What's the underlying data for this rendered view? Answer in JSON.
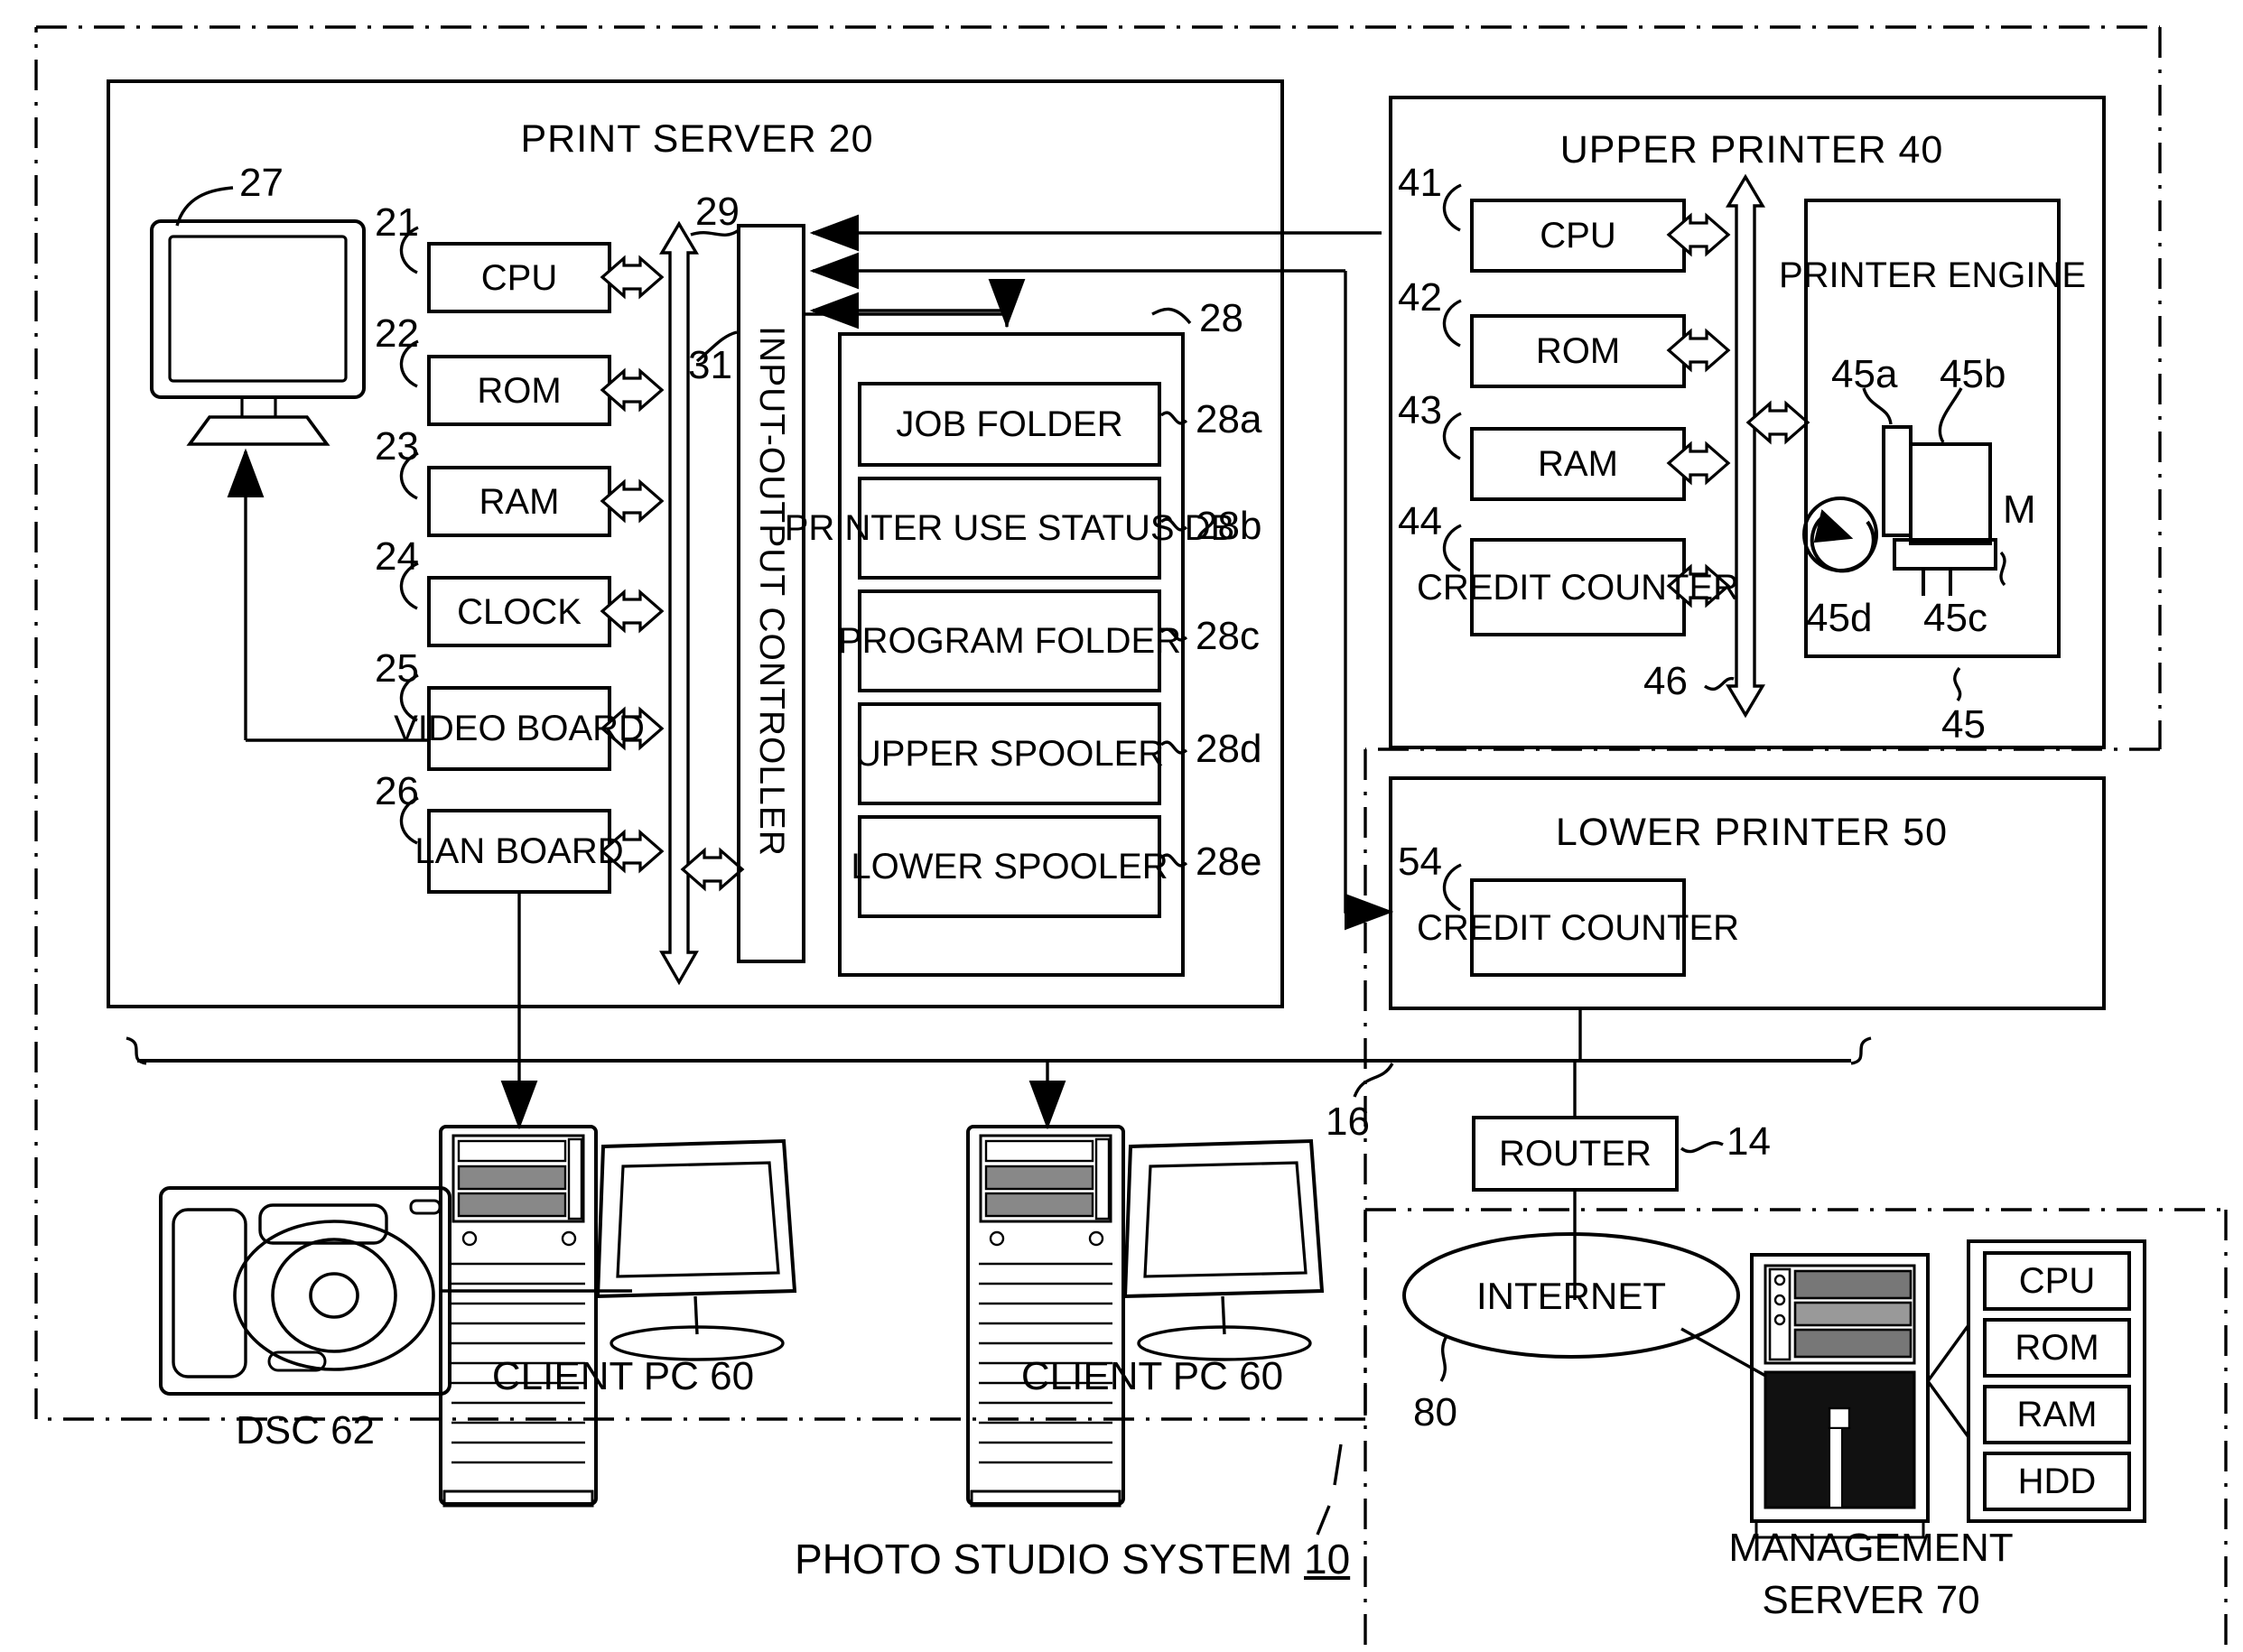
{
  "figure": {
    "caption": "PHOTO STUDIO SYSTEM",
    "caption_ref": "10"
  },
  "print_server": {
    "title": "PRINT SERVER 20",
    "monitor_ref": "27",
    "components": [
      {
        "ref": "21",
        "label": "CPU"
      },
      {
        "ref": "22",
        "label": "ROM"
      },
      {
        "ref": "23",
        "label": "RAM"
      },
      {
        "ref": "24",
        "label": "CLOCK"
      },
      {
        "ref": "25",
        "label": "VIDEO BOARD"
      },
      {
        "ref": "26",
        "label": "LAN BOARD"
      }
    ],
    "bus_ref": "29",
    "io_controller": {
      "ref": "31",
      "label": "INPUT-OUTPUT CONTROLLER"
    },
    "storage": {
      "ref": "28",
      "items": [
        {
          "ref": "28a",
          "label": "JOB FOLDER"
        },
        {
          "ref": "28b",
          "label": "PRINTER USE STATUS DB"
        },
        {
          "ref": "28c",
          "label": "PROGRAM FOLDER"
        },
        {
          "ref": "28d",
          "label": "UPPER SPOOLER"
        },
        {
          "ref": "28e",
          "label": "LOWER SPOOLER"
        }
      ]
    }
  },
  "upper_printer": {
    "title": "UPPER PRINTER 40",
    "components": [
      {
        "ref": "41",
        "label": "CPU"
      },
      {
        "ref": "42",
        "label": "ROM"
      },
      {
        "ref": "43",
        "label": "RAM"
      },
      {
        "ref": "44",
        "label": "CREDIT COUNTER"
      }
    ],
    "bus_ref": "46",
    "engine": {
      "label": "PRINTER ENGINE",
      "ref": "45",
      "parts": [
        {
          "ref": "45a"
        },
        {
          "ref": "45b"
        },
        {
          "ref": "45c"
        },
        {
          "ref": "45d"
        }
      ],
      "motor_label": "M"
    }
  },
  "lower_printer": {
    "title": "LOWER PRINTER 50",
    "credit_counter": {
      "ref": "54",
      "label": "CREDIT COUNTER"
    }
  },
  "network": {
    "lan_ref": "16",
    "router": {
      "label": "ROUTER",
      "ref": "14"
    },
    "internet": {
      "label": "INTERNET",
      "ref": "80"
    }
  },
  "devices": {
    "camera": {
      "label": "DSC 62"
    },
    "client_pc_1": {
      "label": "CLIENT PC 60"
    },
    "client_pc_2": {
      "label": "CLIENT PC 60"
    }
  },
  "management_server": {
    "label_line1": "MANAGEMENT",
    "label_line2": "SERVER 70",
    "components": [
      {
        "label": "CPU"
      },
      {
        "label": "ROM"
      },
      {
        "label": "RAM"
      },
      {
        "label": "HDD"
      }
    ]
  }
}
